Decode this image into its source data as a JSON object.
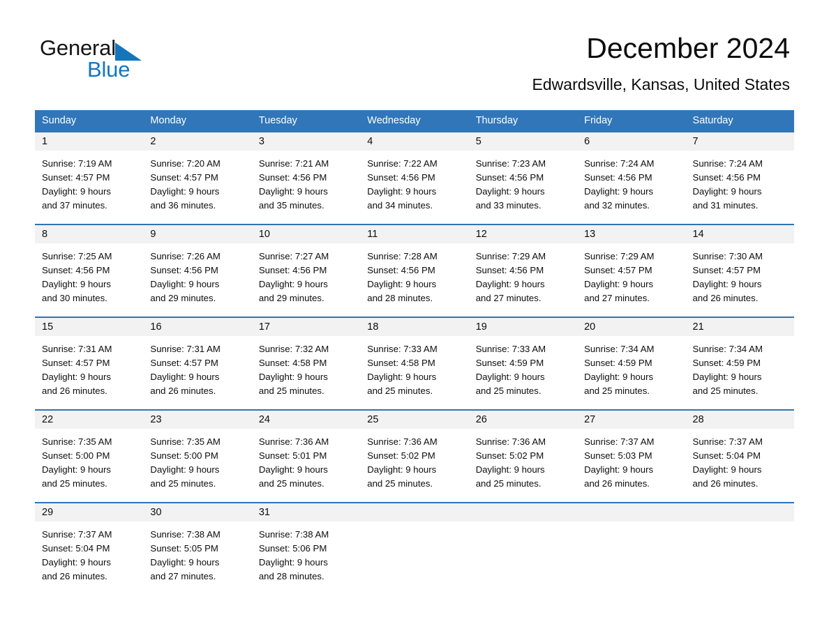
{
  "brand": {
    "name_part1": "General",
    "name_part2": "Blue",
    "triangle_icon": "blue-triangle-icon",
    "accent_color": "#1376bc"
  },
  "header": {
    "title": "December 2024",
    "location": "Edwardsville, Kansas, United States"
  },
  "theme": {
    "header_blue": "#3176b8",
    "row_border_blue": "#2e74b5",
    "day_band_gray": "#f2f2f2"
  },
  "calendar": {
    "weekdays": [
      "Sunday",
      "Monday",
      "Tuesday",
      "Wednesday",
      "Thursday",
      "Friday",
      "Saturday"
    ],
    "weeks": [
      [
        {
          "day": "1",
          "sunrise": "Sunrise: 7:19 AM",
          "sunset": "Sunset: 4:57 PM",
          "daylight_1": "Daylight: 9 hours",
          "daylight_2": "and 37 minutes."
        },
        {
          "day": "2",
          "sunrise": "Sunrise: 7:20 AM",
          "sunset": "Sunset: 4:57 PM",
          "daylight_1": "Daylight: 9 hours",
          "daylight_2": "and 36 minutes."
        },
        {
          "day": "3",
          "sunrise": "Sunrise: 7:21 AM",
          "sunset": "Sunset: 4:56 PM",
          "daylight_1": "Daylight: 9 hours",
          "daylight_2": "and 35 minutes."
        },
        {
          "day": "4",
          "sunrise": "Sunrise: 7:22 AM",
          "sunset": "Sunset: 4:56 PM",
          "daylight_1": "Daylight: 9 hours",
          "daylight_2": "and 34 minutes."
        },
        {
          "day": "5",
          "sunrise": "Sunrise: 7:23 AM",
          "sunset": "Sunset: 4:56 PM",
          "daylight_1": "Daylight: 9 hours",
          "daylight_2": "and 33 minutes."
        },
        {
          "day": "6",
          "sunrise": "Sunrise: 7:24 AM",
          "sunset": "Sunset: 4:56 PM",
          "daylight_1": "Daylight: 9 hours",
          "daylight_2": "and 32 minutes."
        },
        {
          "day": "7",
          "sunrise": "Sunrise: 7:24 AM",
          "sunset": "Sunset: 4:56 PM",
          "daylight_1": "Daylight: 9 hours",
          "daylight_2": "and 31 minutes."
        }
      ],
      [
        {
          "day": "8",
          "sunrise": "Sunrise: 7:25 AM",
          "sunset": "Sunset: 4:56 PM",
          "daylight_1": "Daylight: 9 hours",
          "daylight_2": "and 30 minutes."
        },
        {
          "day": "9",
          "sunrise": "Sunrise: 7:26 AM",
          "sunset": "Sunset: 4:56 PM",
          "daylight_1": "Daylight: 9 hours",
          "daylight_2": "and 29 minutes."
        },
        {
          "day": "10",
          "sunrise": "Sunrise: 7:27 AM",
          "sunset": "Sunset: 4:56 PM",
          "daylight_1": "Daylight: 9 hours",
          "daylight_2": "and 29 minutes."
        },
        {
          "day": "11",
          "sunrise": "Sunrise: 7:28 AM",
          "sunset": "Sunset: 4:56 PM",
          "daylight_1": "Daylight: 9 hours",
          "daylight_2": "and 28 minutes."
        },
        {
          "day": "12",
          "sunrise": "Sunrise: 7:29 AM",
          "sunset": "Sunset: 4:56 PM",
          "daylight_1": "Daylight: 9 hours",
          "daylight_2": "and 27 minutes."
        },
        {
          "day": "13",
          "sunrise": "Sunrise: 7:29 AM",
          "sunset": "Sunset: 4:57 PM",
          "daylight_1": "Daylight: 9 hours",
          "daylight_2": "and 27 minutes."
        },
        {
          "day": "14",
          "sunrise": "Sunrise: 7:30 AM",
          "sunset": "Sunset: 4:57 PM",
          "daylight_1": "Daylight: 9 hours",
          "daylight_2": "and 26 minutes."
        }
      ],
      [
        {
          "day": "15",
          "sunrise": "Sunrise: 7:31 AM",
          "sunset": "Sunset: 4:57 PM",
          "daylight_1": "Daylight: 9 hours",
          "daylight_2": "and 26 minutes."
        },
        {
          "day": "16",
          "sunrise": "Sunrise: 7:31 AM",
          "sunset": "Sunset: 4:57 PM",
          "daylight_1": "Daylight: 9 hours",
          "daylight_2": "and 26 minutes."
        },
        {
          "day": "17",
          "sunrise": "Sunrise: 7:32 AM",
          "sunset": "Sunset: 4:58 PM",
          "daylight_1": "Daylight: 9 hours",
          "daylight_2": "and 25 minutes."
        },
        {
          "day": "18",
          "sunrise": "Sunrise: 7:33 AM",
          "sunset": "Sunset: 4:58 PM",
          "daylight_1": "Daylight: 9 hours",
          "daylight_2": "and 25 minutes."
        },
        {
          "day": "19",
          "sunrise": "Sunrise: 7:33 AM",
          "sunset": "Sunset: 4:59 PM",
          "daylight_1": "Daylight: 9 hours",
          "daylight_2": "and 25 minutes."
        },
        {
          "day": "20",
          "sunrise": "Sunrise: 7:34 AM",
          "sunset": "Sunset: 4:59 PM",
          "daylight_1": "Daylight: 9 hours",
          "daylight_2": "and 25 minutes."
        },
        {
          "day": "21",
          "sunrise": "Sunrise: 7:34 AM",
          "sunset": "Sunset: 4:59 PM",
          "daylight_1": "Daylight: 9 hours",
          "daylight_2": "and 25 minutes."
        }
      ],
      [
        {
          "day": "22",
          "sunrise": "Sunrise: 7:35 AM",
          "sunset": "Sunset: 5:00 PM",
          "daylight_1": "Daylight: 9 hours",
          "daylight_2": "and 25 minutes."
        },
        {
          "day": "23",
          "sunrise": "Sunrise: 7:35 AM",
          "sunset": "Sunset: 5:00 PM",
          "daylight_1": "Daylight: 9 hours",
          "daylight_2": "and 25 minutes."
        },
        {
          "day": "24",
          "sunrise": "Sunrise: 7:36 AM",
          "sunset": "Sunset: 5:01 PM",
          "daylight_1": "Daylight: 9 hours",
          "daylight_2": "and 25 minutes."
        },
        {
          "day": "25",
          "sunrise": "Sunrise: 7:36 AM",
          "sunset": "Sunset: 5:02 PM",
          "daylight_1": "Daylight: 9 hours",
          "daylight_2": "and 25 minutes."
        },
        {
          "day": "26",
          "sunrise": "Sunrise: 7:36 AM",
          "sunset": "Sunset: 5:02 PM",
          "daylight_1": "Daylight: 9 hours",
          "daylight_2": "and 25 minutes."
        },
        {
          "day": "27",
          "sunrise": "Sunrise: 7:37 AM",
          "sunset": "Sunset: 5:03 PM",
          "daylight_1": "Daylight: 9 hours",
          "daylight_2": "and 26 minutes."
        },
        {
          "day": "28",
          "sunrise": "Sunrise: 7:37 AM",
          "sunset": "Sunset: 5:04 PM",
          "daylight_1": "Daylight: 9 hours",
          "daylight_2": "and 26 minutes."
        }
      ],
      [
        {
          "day": "29",
          "sunrise": "Sunrise: 7:37 AM",
          "sunset": "Sunset: 5:04 PM",
          "daylight_1": "Daylight: 9 hours",
          "daylight_2": "and 26 minutes."
        },
        {
          "day": "30",
          "sunrise": "Sunrise: 7:38 AM",
          "sunset": "Sunset: 5:05 PM",
          "daylight_1": "Daylight: 9 hours",
          "daylight_2": "and 27 minutes."
        },
        {
          "day": "31",
          "sunrise": "Sunrise: 7:38 AM",
          "sunset": "Sunset: 5:06 PM",
          "daylight_1": "Daylight: 9 hours",
          "daylight_2": "and 28 minutes."
        },
        {
          "day": "",
          "sunrise": "",
          "sunset": "",
          "daylight_1": "",
          "daylight_2": ""
        },
        {
          "day": "",
          "sunrise": "",
          "sunset": "",
          "daylight_1": "",
          "daylight_2": ""
        },
        {
          "day": "",
          "sunrise": "",
          "sunset": "",
          "daylight_1": "",
          "daylight_2": ""
        },
        {
          "day": "",
          "sunrise": "",
          "sunset": "",
          "daylight_1": "",
          "daylight_2": ""
        }
      ]
    ]
  }
}
